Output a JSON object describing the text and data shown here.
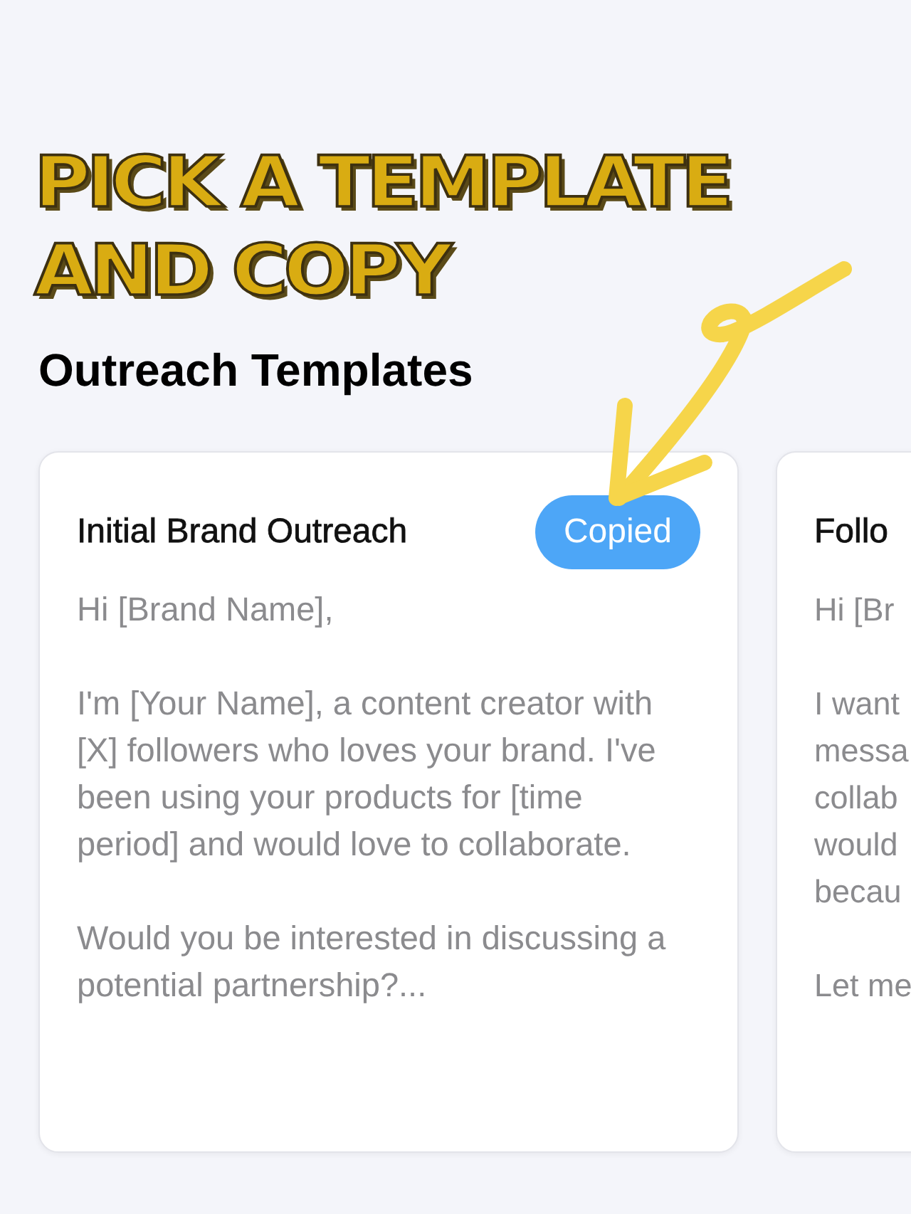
{
  "annotation": {
    "lines": [
      "PICK A TEMPLATE",
      "AND COPY"
    ]
  },
  "heading": "Outreach Templates",
  "templates": [
    {
      "title": "Initial Brand Outreach",
      "badge": {
        "label": "Copied",
        "kind": "copied"
      },
      "paragraphs": [
        "Hi [Brand Name],",
        "I'm [Your Name], a content creator with [X] followers who loves your brand. I've been using your products for [time period] and would love to collaborate.",
        "Would you be interested in discussing a potential partnership?..."
      ]
    },
    {
      "title": "Follo",
      "paragraphs": [
        [
          "Hi [Br"
        ],
        [
          "I want",
          "messa",
          "collab",
          "would",
          "becau"
        ],
        [
          "Let me"
        ]
      ]
    }
  ]
}
